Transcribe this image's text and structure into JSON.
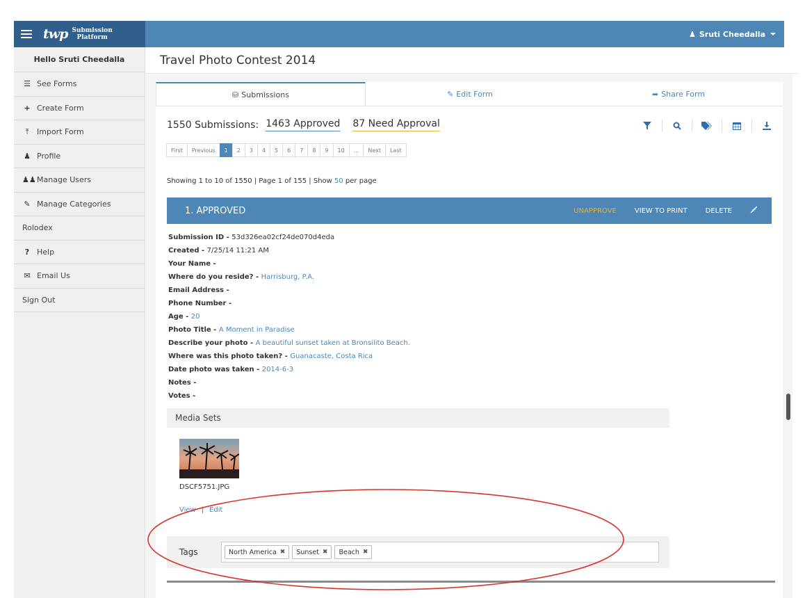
{
  "brand": {
    "mark": "twp",
    "line1": "Submission",
    "line2": "Platform"
  },
  "user_menu": {
    "name": "Sruti Cheedalla"
  },
  "sidebar": {
    "greeting": "Hello Sruti Cheedalla",
    "items": [
      {
        "label": "See Forms",
        "icon": "list-icon"
      },
      {
        "label": "Create Form",
        "icon": "plus-icon"
      },
      {
        "label": "Import Form",
        "icon": "upload-icon"
      },
      {
        "label": "Profile",
        "icon": "user-icon"
      },
      {
        "label": "Manage Users",
        "icon": "users-icon"
      },
      {
        "label": "Manage Categories",
        "icon": "pencil-icon"
      },
      {
        "label": "Rolodex",
        "icon": ""
      },
      {
        "label": "Help",
        "icon": "question-icon"
      },
      {
        "label": "Email Us",
        "icon": "envelope-icon"
      },
      {
        "label": "Sign Out",
        "icon": ""
      }
    ]
  },
  "page": {
    "title": "Travel Photo Contest 2014"
  },
  "tabs": [
    {
      "label": "Submissions",
      "icon": "database-icon"
    },
    {
      "label": "Edit Form",
      "icon": "edit-icon"
    },
    {
      "label": "Share Form",
      "icon": "share-icon"
    }
  ],
  "summary": {
    "total": "1550 Submissions:",
    "approved": "1463 Approved",
    "need_approval": "87 Need Approval"
  },
  "toolbar": [
    "filter-icon",
    "search-icon",
    "tags-icon",
    "calendar-icon",
    "download-icon"
  ],
  "pager": {
    "first": "First",
    "previous": "Previous",
    "pages": [
      "1",
      "2",
      "3",
      "4",
      "5",
      "6",
      "7",
      "8",
      "9",
      "10",
      "..."
    ],
    "next": "Next",
    "last": "Last"
  },
  "showing": {
    "prefix": "Showing 1 to 10 of 1550 | Page 1 of 155 | Show ",
    "per_page": "50",
    "suffix": " per page"
  },
  "submission": {
    "header": "1. APPROVED",
    "actions": {
      "unapprove": "UNAPPROVE",
      "print": "VIEW TO PRINT",
      "delete": "DELETE"
    },
    "fields": [
      {
        "key": "Submission ID - ",
        "value": "53d326ea02cf24de070d4eda",
        "link": false
      },
      {
        "key": "Created - ",
        "value": "7/25/14 11:21 AM",
        "link": false
      },
      {
        "key": "Your Name - ",
        "value": "",
        "link": false
      },
      {
        "key": "Where do you reside? - ",
        "value": "Harrisburg, P.A.",
        "link": true
      },
      {
        "key": "Email Address - ",
        "value": "",
        "link": false
      },
      {
        "key": "Phone Number - ",
        "value": "",
        "link": false
      },
      {
        "key": "Age - ",
        "value": "20",
        "link": true
      },
      {
        "key": "Photo Title - ",
        "value": "A Moment in Paradise",
        "link": true
      },
      {
        "key": "Describe your photo - ",
        "value": "A beautiful sunset taken at Bronsilito Beach.",
        "link": true
      },
      {
        "key": "Where was this photo taken? - ",
        "value": "Guanacaste, Costa Rica",
        "link": true
      },
      {
        "key": "Date photo was taken - ",
        "value": "2014-6-3",
        "link": true
      },
      {
        "key": "Notes - ",
        "value": "",
        "link": false
      },
      {
        "key": "Votes - ",
        "value": "",
        "link": false
      }
    ],
    "media": {
      "heading": "Media Sets",
      "filename": "DSCF5751.JPG",
      "view": "View",
      "separator": "|",
      "edit": "Edit"
    },
    "tags": {
      "label": "Tags",
      "items": [
        "North America",
        "Sunset",
        "Beach"
      ],
      "remove_glyph": "✖"
    }
  },
  "colors": {
    "primary": "#4e86b5",
    "brand_dark": "#2f5f8a",
    "warning": "#e6b23a",
    "annotation": "#d9342b"
  }
}
